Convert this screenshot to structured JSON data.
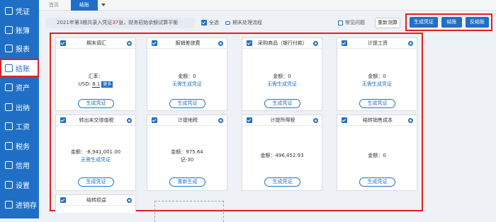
{
  "sidebar": {
    "items": [
      {
        "label": "凭证",
        "icon": "voucher-icon"
      },
      {
        "label": "账簿",
        "icon": "ledger-icon"
      },
      {
        "label": "报表",
        "icon": "report-icon"
      },
      {
        "label": "结账",
        "icon": "closing-icon",
        "active": true
      },
      {
        "label": "资产",
        "icon": "asset-icon"
      },
      {
        "label": "出纳",
        "icon": "cashier-icon"
      },
      {
        "label": "工资",
        "icon": "salary-icon"
      },
      {
        "label": "税务",
        "icon": "tax-icon"
      },
      {
        "label": "信用",
        "icon": "credit-icon"
      },
      {
        "label": "设置",
        "icon": "settings-icon"
      },
      {
        "label": "进销存",
        "icon": "inventory-icon"
      }
    ]
  },
  "tabs": [
    {
      "label": "首页"
    },
    {
      "label": "结账"
    }
  ],
  "info": {
    "prefix": "2021年第3期共录入凭证",
    "count": "37",
    "suffix": "张，财务初始余额试算平衡"
  },
  "toolbar": {
    "select_all": "全选",
    "process": "期末处理流程",
    "faq": "常见问题",
    "recalc": "重新测算",
    "gen_voucher": "生成凭证",
    "close": "结账",
    "reverse": "反结账"
  },
  "cards": [
    {
      "title": "期末调汇",
      "line1": "汇率：",
      "line2_label": "USD:",
      "line2_value": "8.1",
      "more": "更多",
      "button": "生成凭证"
    },
    {
      "title": "报销差旅费",
      "line1": "金额：0",
      "link": "无需生成凭证",
      "button": "生成凭证"
    },
    {
      "title": "采购商品（银行付款）",
      "line1": "金额：0",
      "link": "无需生成凭证",
      "button": "生成凭证"
    },
    {
      "title": "计提工资",
      "line1": "金额：0",
      "link": "无需生成凭证",
      "button": "生成凭证"
    },
    {
      "title": "转出未交增值税",
      "line1": "金额：-8,941,001.00",
      "link": "无需生成凭证",
      "button": "生成凭证"
    },
    {
      "title": "计提地税",
      "line1": "金额：975.64",
      "line2": "记-30",
      "button": "重新生成"
    },
    {
      "title": "计提所得税",
      "line1": "金额：496,452.93",
      "button": "生成凭证"
    },
    {
      "title": "结转销售成本",
      "line1": "金额：0",
      "button": "生成凭证"
    },
    {
      "title": "结转损益"
    }
  ],
  "colors": {
    "accent": "#1f6fc6",
    "highlight": "#e02020"
  }
}
